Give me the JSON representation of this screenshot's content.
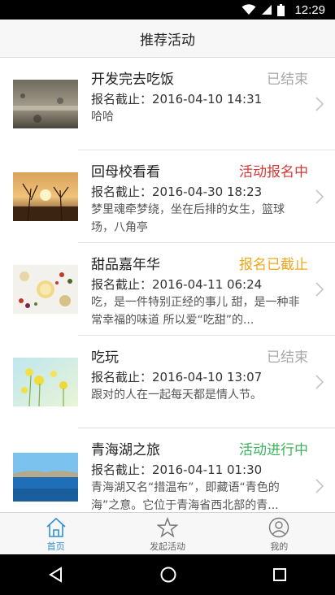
{
  "statusbar": {
    "time": "12:29"
  },
  "header": {
    "title": "推荐活动"
  },
  "activities": [
    {
      "title": "开发完去吃饭",
      "status": "已结束",
      "status_color": "#a8a8a8",
      "deadline": "报名截止：2016-04-10 14:31",
      "description": "哈哈"
    },
    {
      "title": "回母校看看",
      "status": "活动报名中",
      "status_color": "#d63a35",
      "deadline": "报名截止：2016-04-30 18:23",
      "description": "梦里魂牵梦绕，坐在后排的女生，篮球场，八角亭"
    },
    {
      "title": "甜品嘉年华",
      "status": "报名已截止",
      "status_color": "#f0a71b",
      "deadline": "报名截止：2016-04-11 06:24",
      "description": "吃，是一件特别正经的事儿 甜，是一种非常幸福的味道 所以爱“吃甜”的..."
    },
    {
      "title": "吃玩",
      "status": "已结束",
      "status_color": "#a8a8a8",
      "deadline": "报名截止：2016-04-10 13:07",
      "description": "跟对的人在一起每天都是情人节。"
    },
    {
      "title": "青海湖之旅",
      "status": "活动进行中",
      "status_color": "#3cb25c",
      "deadline": "报名截止：2016-04-11 01:30",
      "description": "青海湖又名“措温布”，即藏语“青色的海”之意。它位于青海省西北部的青..."
    }
  ],
  "tabs": [
    {
      "label": "首页",
      "icon": "home-icon",
      "active": true
    },
    {
      "label": "发起活动",
      "icon": "star-icon",
      "active": false
    },
    {
      "label": "我的",
      "icon": "user-icon",
      "active": false
    }
  ],
  "colors": {
    "accent": "#2f8fd6"
  }
}
